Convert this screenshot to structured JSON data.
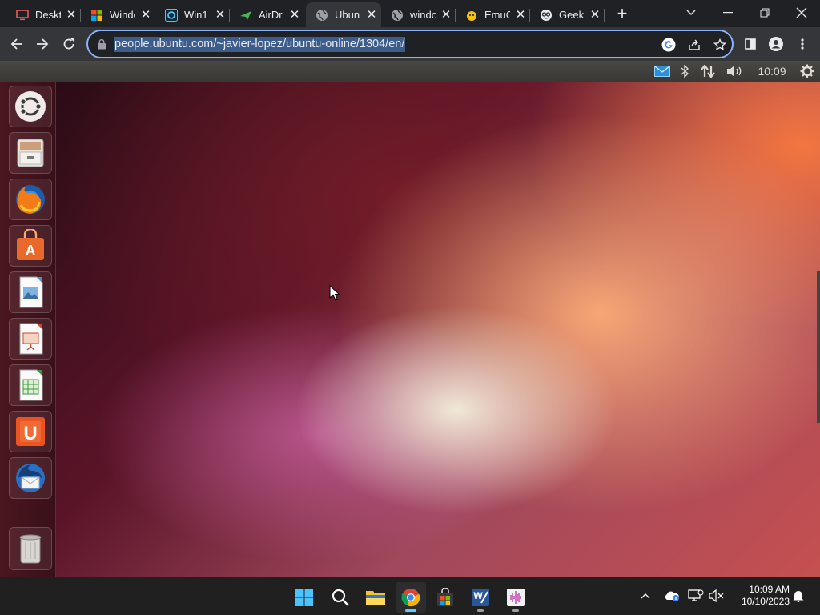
{
  "browser": {
    "tabs": [
      {
        "title": "Deskt",
        "icon": "desktop-icon"
      },
      {
        "title": "Windo",
        "icon": "windows-flag-icon"
      },
      {
        "title": "Win1",
        "icon": "win1-app-icon"
      },
      {
        "title": "AirDr",
        "icon": "airdroid-icon"
      },
      {
        "title": "Ubun",
        "icon": "globe-icon",
        "active": true
      },
      {
        "title": "windo",
        "icon": "globe-icon"
      },
      {
        "title": "EmuC",
        "icon": "emuc-icon"
      },
      {
        "title": "Geek",
        "icon": "geek-icon"
      }
    ],
    "close_glyph": "✕",
    "new_tab_glyph": "+",
    "url": "people.ubuntu.com/~javier-lopez/ubuntu-online/1304/en/"
  },
  "ubuntu": {
    "panel": {
      "time": "10:09"
    },
    "launcher_items": [
      "ubuntu-dash-icon",
      "files-icon",
      "firefox-icon",
      "software-center-icon",
      "image-viewer-icon",
      "impress-icon",
      "calc-icon",
      "ubuntu-one-icon",
      "thunderbird-icon",
      "trash-icon"
    ],
    "ubuntu_one_letter": "U",
    "software_center_letter": "A"
  },
  "taskbar": {
    "time": "10:09 AM",
    "date": "10/10/2023",
    "word_letter": "W"
  },
  "colors": {
    "accent": "#8ab4f8",
    "taskbar_active": "#60cdff",
    "ubuntu_orange": "#e95420"
  }
}
